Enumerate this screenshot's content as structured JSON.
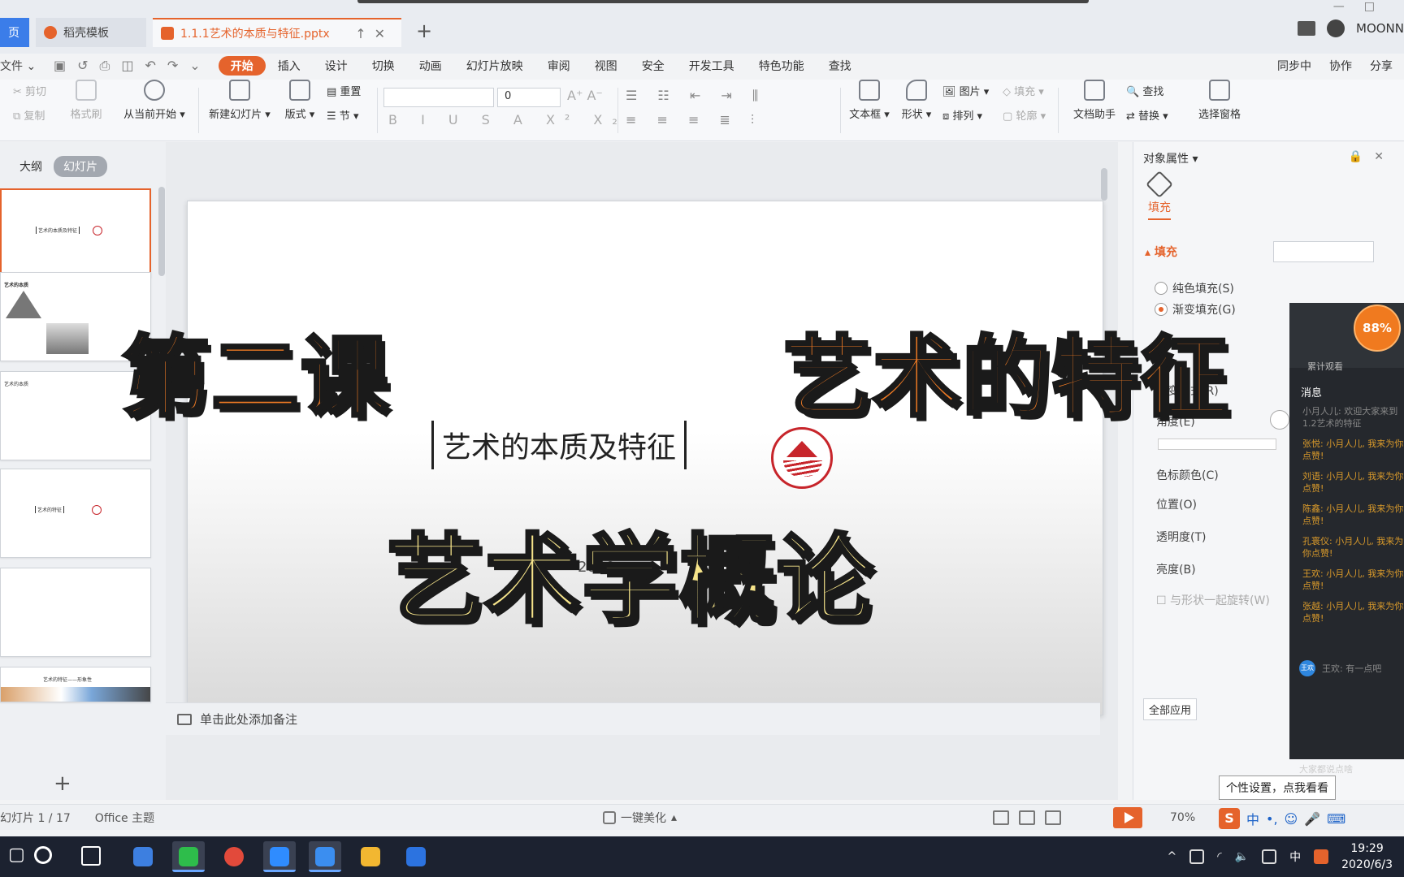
{
  "tabs": {
    "home": "页",
    "templates": "稻壳模板",
    "document": "1.1.1艺术的本质与特征.pptx",
    "account_name": "MOONN"
  },
  "menu": {
    "file": "文件",
    "items": [
      "开始",
      "插入",
      "设计",
      "切换",
      "动画",
      "幻灯片放映",
      "审阅",
      "视图",
      "安全",
      "开发工具",
      "特色功能",
      "查找"
    ],
    "right": [
      "同步中",
      "协作",
      "分享"
    ]
  },
  "ribbon": {
    "cut": "剪切",
    "copy": "复制",
    "format_painter": "格式刷",
    "from_current": "从当前开始",
    "new_slide": "新建幻灯片",
    "layout": "版式",
    "reset": "重置",
    "section": "节",
    "font_size": "0",
    "textbox": "文本框",
    "shape": "形状",
    "picture": "图片",
    "fill": "填充",
    "arrange": "排列",
    "outline": "轮廓",
    "doc_assistant": "文档助手",
    "find": "查找",
    "replace": "替换",
    "select_pane": "选择窗格"
  },
  "left_panel": {
    "outline": "大纲",
    "slides": "幻灯片",
    "thumbs": [
      {
        "text": "艺术的本质及特征"
      },
      {
        "text": "艺术的本质"
      },
      {
        "text": "艺术的本质"
      },
      {
        "text": "艺术的特征"
      },
      {
        "text": ""
      },
      {
        "text": "艺术的特征——形象性"
      }
    ]
  },
  "slide": {
    "title": "艺术的本质及特征",
    "date": "2020"
  },
  "overlay_text": {
    "lesson": "第二课",
    "feature": "艺术的特征",
    "course": "艺术学概论"
  },
  "notes_placeholder": "单击此处添加备注",
  "right_panel": {
    "title": "对象属性",
    "tab_fill": "填充",
    "section": "填充",
    "options": [
      "纯色填充(S)",
      "渐变填充(G)"
    ],
    "props": [
      "渐变样式(R)",
      "角度(E)",
      "色标颜色(C)",
      "位置(O)",
      "透明度(T)",
      "亮度(B)",
      "与形状一起旋转(W)"
    ],
    "apply_all": "全部应用"
  },
  "stream": {
    "percent": "88%",
    "accumulated": "累计观看",
    "messages_title": "消息",
    "messages": [
      {
        "text": "小月人儿: 欢迎大家来到 1.2艺术的特征",
        "gray": true
      },
      {
        "text": "张悦: 小月人儿, 我来为你点赞!",
        "gray": false
      },
      {
        "text": "刘语: 小月人儿, 我来为你点赞!",
        "gray": false
      },
      {
        "text": "陈鑫: 小月人儿, 我来为你点赞!",
        "gray": false
      },
      {
        "text": "孔寰仪: 小月人儿, 我来为你点赞!",
        "gray": false
      },
      {
        "text": "王欢: 小月人儿, 我来为你点赞!",
        "gray": false
      },
      {
        "text": "张越: 小月人儿, 我来为你点赞!",
        "gray": false
      }
    ],
    "badge": "王欢",
    "badge_msg": "王欢: 有一点吧",
    "say": "大家都说点啥"
  },
  "tooltip": "个性设置，点我看看",
  "status": {
    "pages": "幻灯片 1 / 17",
    "theme": "Office 主题",
    "beautify": "一键美化",
    "zoom": "70%"
  },
  "ime": {
    "lang": "中"
  },
  "taskbar": {
    "time": "19:29",
    "date": "2020/6/3",
    "lang": "中"
  },
  "colors": {
    "accent": "#e5632c",
    "lesson_text": "#ee7a24",
    "course_text": "#f6e48a"
  }
}
